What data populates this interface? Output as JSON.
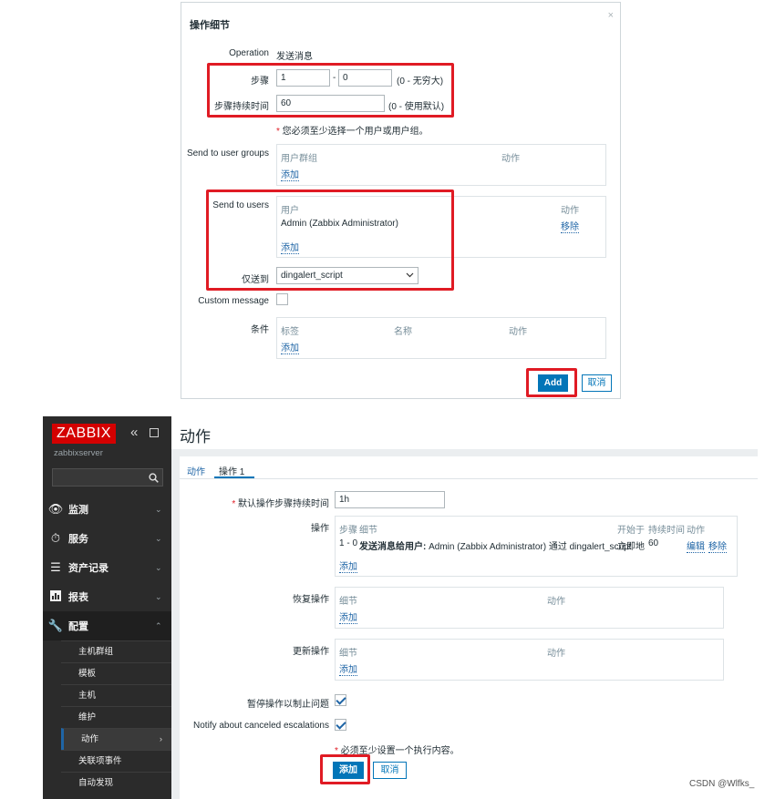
{
  "dialog": {
    "title": "操作细节",
    "close": "×",
    "operation_label": "Operation",
    "operation_value": "发送消息",
    "step_label": "步骤",
    "step_from": "1",
    "step_sep": "-",
    "step_to": "0",
    "step_hint": "(0 - 无穷大)",
    "duration_label": "步骤持续时间",
    "duration_value": "60",
    "duration_hint": "(0 - 使用默认)",
    "required_note": "您必须至少选择一个用户或用户组。",
    "send_groups_label": "Send to user groups",
    "groups_col_group": "用户群组",
    "groups_col_action": "动作",
    "groups_add": "添加",
    "send_users_label": "Send to users",
    "users_col_user": "用户",
    "users_col_action": "动作",
    "users_row_name": "Admin (Zabbix Administrator)",
    "users_row_remove": "移除",
    "users_add": "添加",
    "only_to_label": "仅送到",
    "only_to_value": "dingalert_script",
    "custom_msg_label": "Custom message",
    "conditions_label": "条件",
    "cond_col_label": "标签",
    "cond_col_name": "名称",
    "cond_col_action": "动作",
    "cond_add": "添加",
    "add_button": "Add",
    "cancel_button": "取消"
  },
  "sidebar": {
    "logo": "ZABBIX",
    "server": "zabbixserver",
    "search_placeholder": "",
    "nav": [
      {
        "label": "监测",
        "icon": "eye-icon"
      },
      {
        "label": "服务",
        "icon": "clock-icon"
      },
      {
        "label": "资产记录",
        "icon": "list-icon"
      },
      {
        "label": "报表",
        "icon": "chart-icon"
      },
      {
        "label": "配置",
        "icon": "wrench-icon"
      }
    ],
    "sub": [
      "主机群组",
      "模板",
      "主机",
      "维护",
      "动作",
      "关联项事件",
      "自动发现"
    ]
  },
  "main": {
    "title": "动作",
    "tabs": [
      "动作",
      "操作 1"
    ],
    "default_duration_label": "默认操作步骤持续时间",
    "default_duration_value": "1h",
    "ops_label": "操作",
    "ops_cols": [
      "步骤",
      "细节",
      "开始于",
      "持续时间",
      "动作"
    ],
    "ops_row": {
      "step": "1 - 0",
      "detail_bold": "发送消息给用户:",
      "detail_rest": " Admin (Zabbix Administrator) 通过 dingalert_script",
      "start": "立即地",
      "duration": "60",
      "edit": "编辑",
      "remove": "移除"
    },
    "ops_add": "添加",
    "recovery_label": "恢复操作",
    "recovery_cols": [
      "细节",
      "动作"
    ],
    "recovery_add": "添加",
    "update_label": "更新操作",
    "update_cols": [
      "细节",
      "动作"
    ],
    "update_add": "添加",
    "pause_label": "暂停操作以制止问题",
    "notify_label": "Notify about canceled escalations",
    "required_note": "必须至少设置一个执行内容。",
    "add_button": "添加",
    "cancel_button": "取消"
  },
  "watermark": "CSDN @Wlfks_",
  "colors": {
    "accent": "#0275b8",
    "highlight_box": "#e01b24",
    "logo_bg": "#d40000",
    "sidebar_bg": "#2b2b2b"
  }
}
